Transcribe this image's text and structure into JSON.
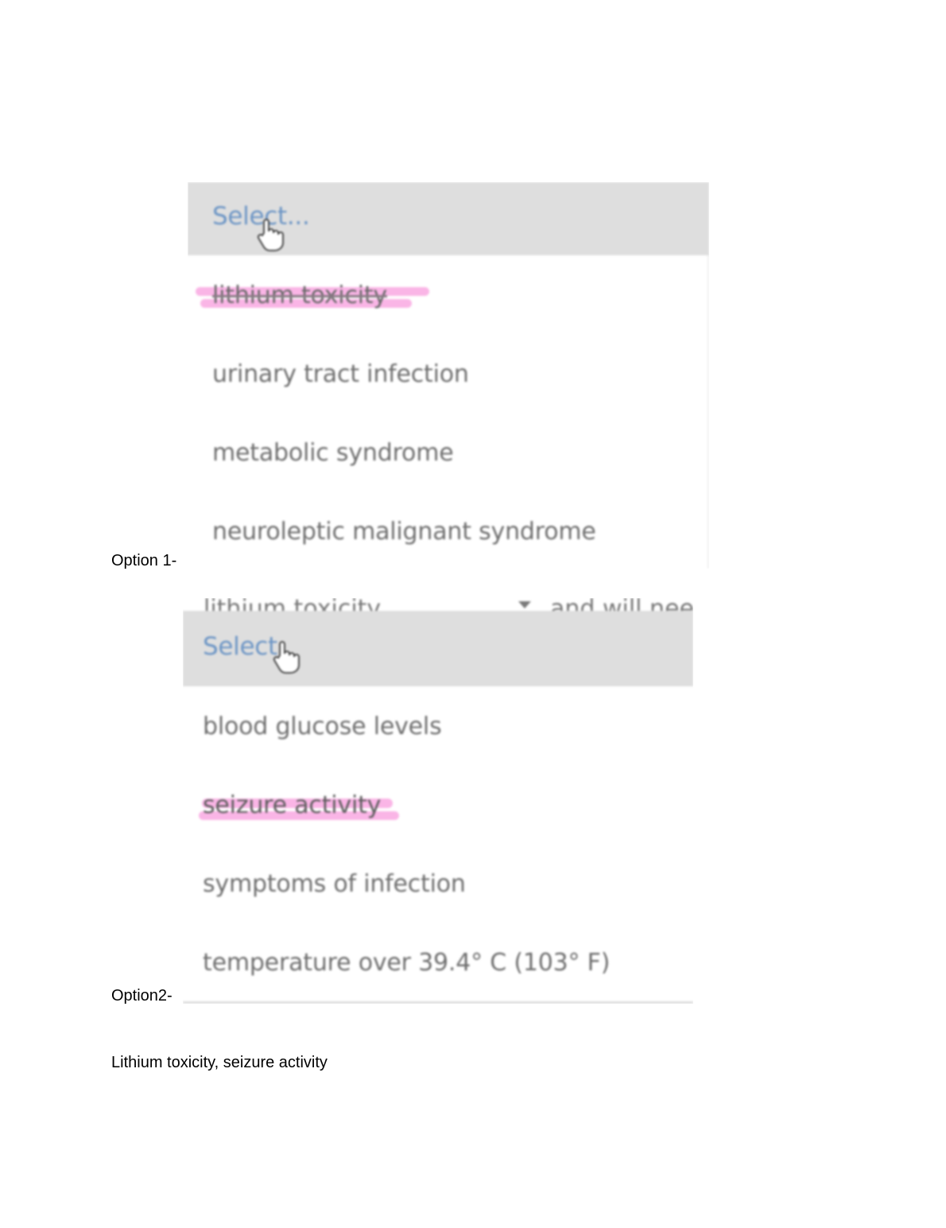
{
  "option1": {
    "caption": "Option 1-",
    "dropdown": {
      "placeholder": "Select...",
      "options": [
        {
          "label": "lithium toxicity",
          "highlighted": true
        },
        {
          "label": "urinary tract infection",
          "highlighted": false
        },
        {
          "label": "metabolic syndrome",
          "highlighted": false
        },
        {
          "label": "neuroleptic malignant syndrome",
          "highlighted": false
        }
      ]
    }
  },
  "option2": {
    "caption": "Option2-",
    "context": {
      "selected_value": "lithium toxicity",
      "following_text": "and will nee"
    },
    "dropdown": {
      "placeholder": "Select",
      "options": [
        {
          "label": "blood glucose levels",
          "highlighted": false
        },
        {
          "label": "seizure activity",
          "highlighted": true
        },
        {
          "label": "symptoms of infection",
          "highlighted": false
        },
        {
          "label": "temperature over 39.4° C (103° F)",
          "highlighted": false
        }
      ]
    }
  },
  "answer": "Lithium toxicity, seizure activity",
  "colors": {
    "select_bar": "#dedede",
    "select_text": "#6c95c5",
    "option_text": "#6e6e6e",
    "highlight": "#f578d2"
  },
  "icons": {
    "cursor": "hand-pointer-icon",
    "dropdown": "caret-down-icon"
  }
}
